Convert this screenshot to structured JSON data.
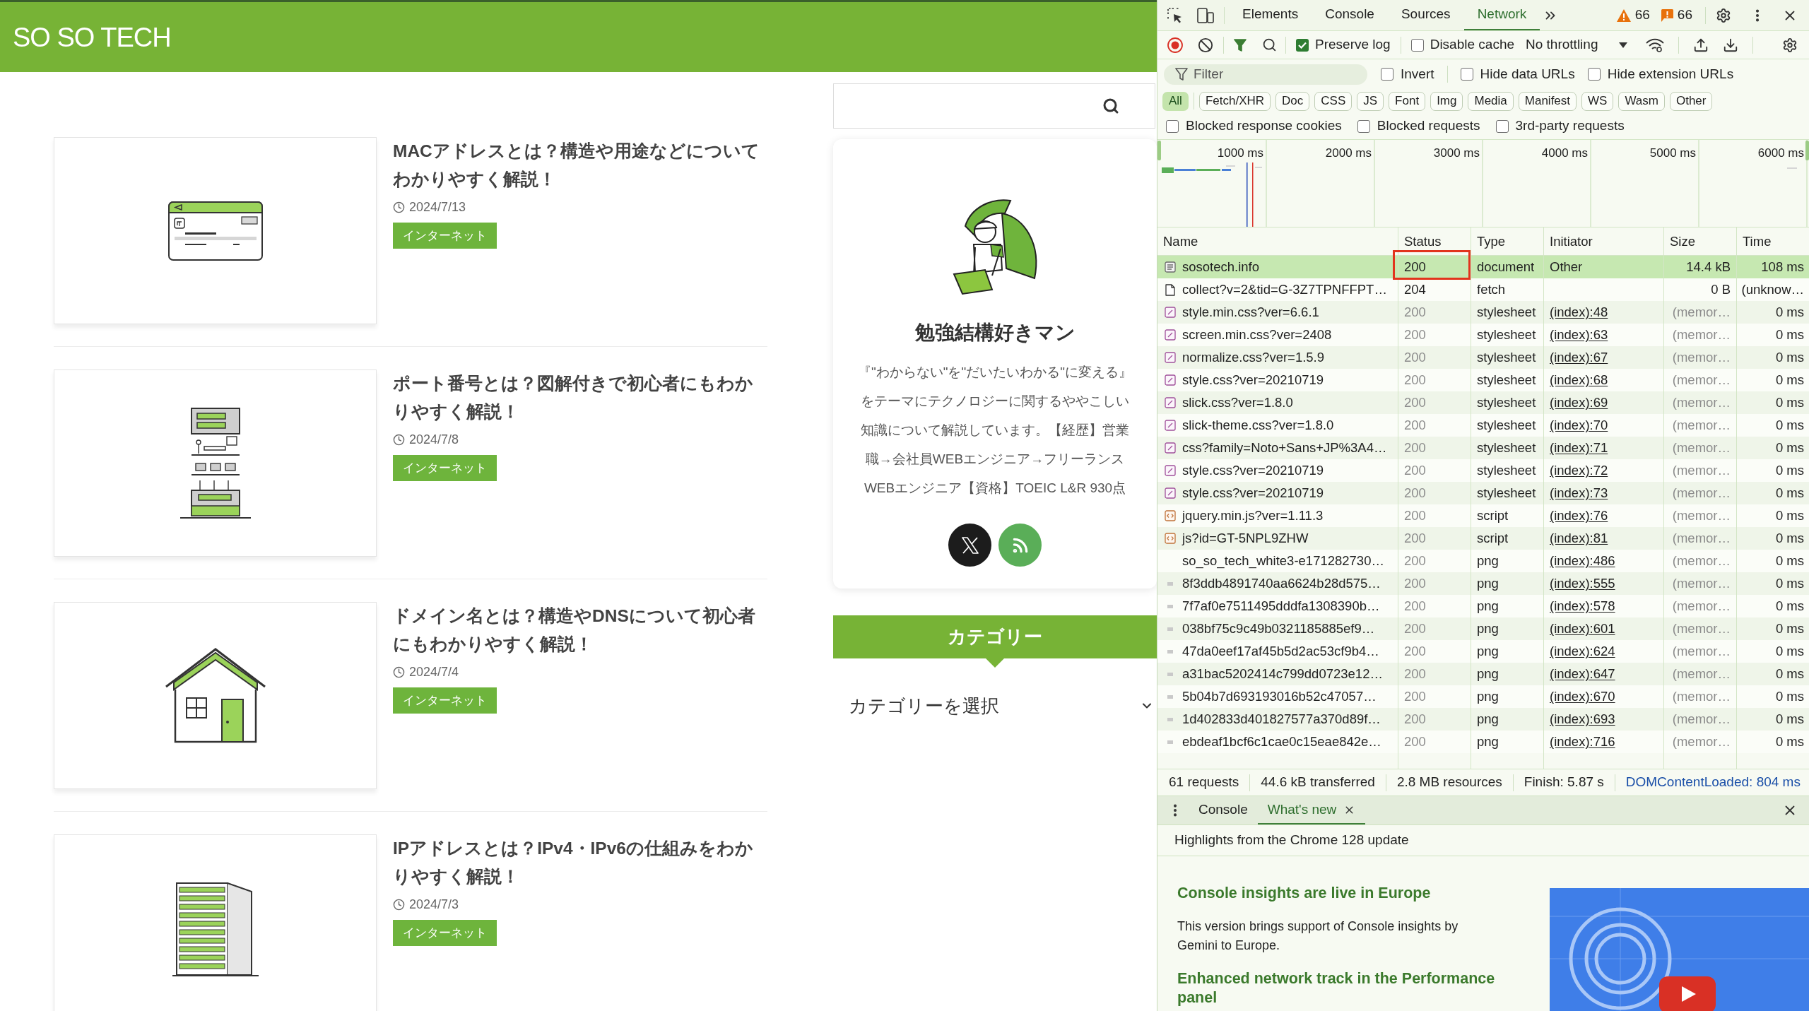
{
  "site": {
    "logo": "SO SO TECH",
    "articles": [
      {
        "title": "MACアドレスとは？構造や用途などについてわかりやすく解説！",
        "date": "2024/7/13",
        "tag": "インターネット",
        "kind": "card"
      },
      {
        "title": "ポート番号とは？図解付きで初心者にもわかりやすく解説！",
        "date": "2024/7/8",
        "tag": "インターネット",
        "kind": "floors"
      },
      {
        "title": "ドメイン名とは？構造やDNSについて初心者にもわかりやすく解説！",
        "date": "2024/7/4",
        "tag": "インターネット",
        "kind": "house"
      },
      {
        "title": "IPアドレスとは？IPv4・IPv6の仕組みをわかりやすく解説！",
        "date": "2024/7/3",
        "tag": "インターネット",
        "kind": "tower"
      }
    ],
    "profile": {
      "name": "勉強結構好きマン",
      "bio": "『\"わからない\"を\"だいたいわかる\"に変える』をテーマにテクノロジーに関するややこしい知識について解説しています。【経歴】営業職→会社員WEBエンジニア→フリーランスWEBエンジニア【資格】TOEIC L&R 930点",
      "socials": [
        {
          "kind": "x"
        },
        {
          "kind": "rss"
        }
      ]
    },
    "category": {
      "heading": "カテゴリー",
      "select": "カテゴリーを選択"
    }
  },
  "devtools": {
    "tabs": [
      {
        "label": "Elements",
        "selected": false
      },
      {
        "label": "Console",
        "selected": false
      },
      {
        "label": "Sources",
        "selected": false
      },
      {
        "label": "Network",
        "selected": true
      }
    ],
    "counters": [
      {
        "kind": "warning",
        "count": "66"
      },
      {
        "kind": "issue",
        "count": "66"
      }
    ],
    "toolbar": {
      "recording": true,
      "checks": [
        {
          "label": "Preserve log",
          "checked": true
        },
        {
          "label": "Disable cache",
          "checked": false
        }
      ],
      "throttling": "No throttling"
    },
    "filter": {
      "placeholder": "Filter",
      "options": [
        {
          "label": "Invert",
          "checked": false
        },
        {
          "label": "Hide data URLs",
          "checked": false
        },
        {
          "label": "Hide extension URLs",
          "checked": false
        }
      ]
    },
    "types": [
      {
        "label": "All",
        "selected": true
      },
      {
        "label": "Fetch/XHR",
        "selected": false
      },
      {
        "label": "Doc",
        "selected": false
      },
      {
        "label": "CSS",
        "selected": false
      },
      {
        "label": "JS",
        "selected": false
      },
      {
        "label": "Font",
        "selected": false
      },
      {
        "label": "Img",
        "selected": false
      },
      {
        "label": "Media",
        "selected": false
      },
      {
        "label": "Manifest",
        "selected": false
      },
      {
        "label": "WS",
        "selected": false
      },
      {
        "label": "Wasm",
        "selected": false
      },
      {
        "label": "Other",
        "selected": false
      }
    ],
    "more_filters": [
      {
        "label": "Blocked response cookies",
        "checked": false
      },
      {
        "label": "Blocked requests",
        "checked": false
      },
      {
        "label": "3rd-party requests",
        "checked": false
      }
    ],
    "timeline": {
      "ticks": [
        "1000 ms",
        "2000 ms",
        "3000 ms",
        "4000 ms",
        "5000 ms",
        "6000 ms"
      ]
    },
    "table": {
      "columns": [
        "Name",
        "Status",
        "Type",
        "Initiator",
        "Size",
        "Time"
      ],
      "rows": [
        {
          "name": "sosotech.info",
          "status": "200",
          "type": "document",
          "initiator": "Other",
          "size": "14.4 kB",
          "time": "108 ms",
          "kind": "document",
          "selected": true,
          "cached": false,
          "link": false,
          "marked": true
        },
        {
          "name": "collect?v=2&tid=G-3Z7TPNFFPT…",
          "status": "204",
          "type": "fetch",
          "size": "0 B",
          "time": "(unknow…",
          "kind": "file",
          "selected": false,
          "cached": false,
          "marked": false
        },
        {
          "name": "style.min.css?ver=6.6.1",
          "status": "200",
          "type": "stylesheet",
          "initiator": "(index):48",
          "size": "(memor…",
          "time": "0 ms",
          "kind": "stylesheet",
          "selected": false,
          "cached": true,
          "link": true,
          "marked": false
        },
        {
          "name": "screen.min.css?ver=2408",
          "status": "200",
          "type": "stylesheet",
          "initiator": "(index):63",
          "size": "(memor…",
          "time": "0 ms",
          "kind": "stylesheet",
          "selected": false,
          "cached": true,
          "link": true,
          "marked": false
        },
        {
          "name": "normalize.css?ver=1.5.9",
          "status": "200",
          "type": "stylesheet",
          "initiator": "(index):67",
          "size": "(memor…",
          "time": "0 ms",
          "kind": "stylesheet",
          "selected": false,
          "cached": true,
          "link": true,
          "marked": false
        },
        {
          "name": "style.css?ver=20210719",
          "status": "200",
          "type": "stylesheet",
          "initiator": "(index):68",
          "size": "(memor…",
          "time": "0 ms",
          "kind": "stylesheet",
          "selected": false,
          "cached": true,
          "link": true,
          "marked": false
        },
        {
          "name": "slick.css?ver=1.8.0",
          "status": "200",
          "type": "stylesheet",
          "initiator": "(index):69",
          "size": "(memor…",
          "time": "0 ms",
          "kind": "stylesheet",
          "selected": false,
          "cached": true,
          "link": true,
          "marked": false
        },
        {
          "name": "slick-theme.css?ver=1.8.0",
          "status": "200",
          "type": "stylesheet",
          "initiator": "(index):70",
          "size": "(memor…",
          "time": "0 ms",
          "kind": "stylesheet",
          "selected": false,
          "cached": true,
          "link": true,
          "marked": false
        },
        {
          "name": "css?family=Noto+Sans+JP%3A4…",
          "status": "200",
          "type": "stylesheet",
          "initiator": "(index):71",
          "size": "(memor…",
          "time": "0 ms",
          "kind": "stylesheet",
          "selected": false,
          "cached": true,
          "link": true,
          "marked": false
        },
        {
          "name": "style.css?ver=20210719",
          "status": "200",
          "type": "stylesheet",
          "initiator": "(index):72",
          "size": "(memor…",
          "time": "0 ms",
          "kind": "stylesheet",
          "selected": false,
          "cached": true,
          "link": true,
          "marked": false
        },
        {
          "name": "style.css?ver=20210719",
          "status": "200",
          "type": "stylesheet",
          "initiator": "(index):73",
          "size": "(memor…",
          "time": "0 ms",
          "kind": "stylesheet",
          "selected": false,
          "cached": true,
          "link": true,
          "marked": false
        },
        {
          "name": "jquery.min.js?ver=1.11.3",
          "status": "200",
          "type": "script",
          "initiator": "(index):76",
          "size": "(memor…",
          "time": "0 ms",
          "kind": "script",
          "selected": false,
          "cached": true,
          "link": true,
          "marked": false
        },
        {
          "name": "js?id=GT-5NPL9ZHW",
          "status": "200",
          "type": "script",
          "initiator": "(index):81",
          "size": "(memor…",
          "time": "0 ms",
          "kind": "script",
          "selected": false,
          "cached": true,
          "link": true,
          "marked": false
        },
        {
          "name": "so_so_tech_white3-e171282730…",
          "status": "200",
          "type": "png",
          "initiator": "(index):486",
          "size": "(memor…",
          "time": "0 ms",
          "kind": "none",
          "selected": false,
          "cached": true,
          "link": true,
          "marked": false
        },
        {
          "name": "8f3ddb4891740aa6624b28d575…",
          "status": "200",
          "type": "png",
          "initiator": "(index):555",
          "size": "(memor…",
          "time": "0 ms",
          "kind": "image",
          "selected": false,
          "cached": true,
          "link": true,
          "marked": false
        },
        {
          "name": "7f7af0e7511495dddfa1308390b…",
          "status": "200",
          "type": "png",
          "initiator": "(index):578",
          "size": "(memor…",
          "time": "0 ms",
          "kind": "image",
          "selected": false,
          "cached": true,
          "link": true,
          "marked": false
        },
        {
          "name": "038bf75c9c49b0321185885ef9…",
          "status": "200",
          "type": "png",
          "initiator": "(index):601",
          "size": "(memor…",
          "time": "0 ms",
          "kind": "image",
          "selected": false,
          "cached": true,
          "link": true,
          "marked": false
        },
        {
          "name": "47da0eef17af45b5d2ac53cf9b4…",
          "status": "200",
          "type": "png",
          "initiator": "(index):624",
          "size": "(memor…",
          "time": "0 ms",
          "kind": "image",
          "selected": false,
          "cached": true,
          "link": true,
          "marked": false
        },
        {
          "name": "a31bac5202414c799dd0723e12…",
          "status": "200",
          "type": "png",
          "initiator": "(index):647",
          "size": "(memor…",
          "time": "0 ms",
          "kind": "image",
          "selected": false,
          "cached": true,
          "link": true,
          "marked": false
        },
        {
          "name": "5b04b7d693193016b52c47057…",
          "status": "200",
          "type": "png",
          "initiator": "(index):670",
          "size": "(memor…",
          "time": "0 ms",
          "kind": "image",
          "selected": false,
          "cached": true,
          "link": true,
          "marked": false
        },
        {
          "name": "1d402833d401827577a370d89f…",
          "status": "200",
          "type": "png",
          "initiator": "(index):693",
          "size": "(memor…",
          "time": "0 ms",
          "kind": "image",
          "selected": false,
          "cached": true,
          "link": true,
          "marked": false
        },
        {
          "name": "ebdeaf1bcf6c1cae0c15eae842e…",
          "status": "200",
          "type": "png",
          "initiator": "(index):716",
          "size": "(memor…",
          "time": "0 ms",
          "kind": "image",
          "selected": false,
          "cached": true,
          "link": true,
          "marked": false
        }
      ]
    },
    "status_bar": [
      {
        "text": "61 requests",
        "color": "#1f1f1f"
      },
      {
        "text": "44.6 kB transferred",
        "color": "#1f1f1f"
      },
      {
        "text": "2.8 MB resources",
        "color": "#1f1f1f"
      },
      {
        "text": "Finish: 5.87 s",
        "color": "#1f1f1f"
      },
      {
        "text": "DOMContentLoaded: 804 ms",
        "color": "#1a4fa8"
      }
    ],
    "drawer": {
      "tabs": [
        {
          "label": "Console",
          "selected": false,
          "closable": false
        },
        {
          "label": "What's new",
          "selected": true,
          "closable": true
        }
      ],
      "title": "Highlights from the Chrome 128 update",
      "sections": [
        {
          "heading": "Console insights are live in Europe",
          "body": "This version brings support of Console insights by Gemini to Europe."
        },
        {
          "heading": "Enhanced network track in the Performance panel"
        }
      ]
    }
  }
}
